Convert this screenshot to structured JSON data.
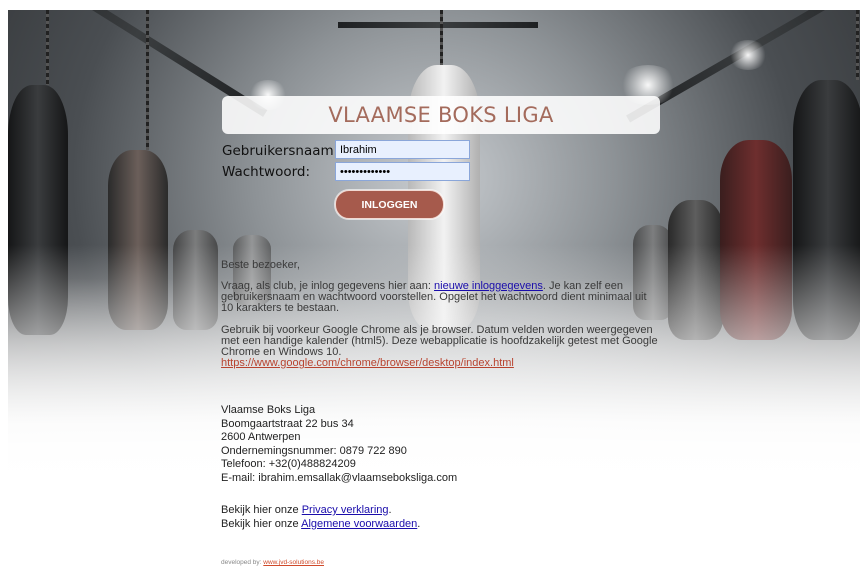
{
  "header": {
    "title": "VLAAMSE BOKS LIGA"
  },
  "login": {
    "username_label": "Gebruikersnaam:",
    "username_value": "Ibrahim",
    "password_label": "Wachtwoord:",
    "password_value": "•••••••••••••",
    "submit_label": "INLOGGEN"
  },
  "info": {
    "greeting": "Beste bezoeker,",
    "p1_before": "Vraag, als club, je inlog gegevens hier aan: ",
    "p1_link": "nieuwe inloggegevens",
    "p1_after": ". Je kan zelf een gebruikersnaam en wachtwoord voorstellen. Opgelet het wachtwoord dient minimaal uit 10 karakters te bestaan.",
    "p2": "Gebruik bij voorkeur Google Chrome als je browser. Datum velden worden weergegeven met een handige kalender (html5). Deze webapplicatie is hoofdzakelijk getest met Google Chrome en Windows 10.",
    "p2_link": "https://www.google.com/chrome/browser/desktop/index.html"
  },
  "address": {
    "name": "Vlaamse Boks Liga",
    "street": "Boomgaartstraat 22 bus 34",
    "city": "2600 Antwerpen",
    "company_number": "Ondernemingsnummer: 0879 722 890",
    "phone": "Telefoon: +32(0)488824209",
    "email": "E-mail: ibrahim.emsallak@vlaamseboksliga.com"
  },
  "legal": {
    "privacy_prefix": "Bekijk hier onze ",
    "privacy_link": "Privacy verklaring",
    "terms_prefix": "Bekijk hier onze ",
    "terms_link": "Algemene voorwaarden"
  },
  "footer": {
    "developed_by": "developed by:",
    "dev_link": "www.jvd-solutions.be"
  },
  "colors": {
    "title": "#a46b5c",
    "button": "#a65a4c",
    "link": "#1a0dab",
    "link_red": "#b8432f"
  }
}
